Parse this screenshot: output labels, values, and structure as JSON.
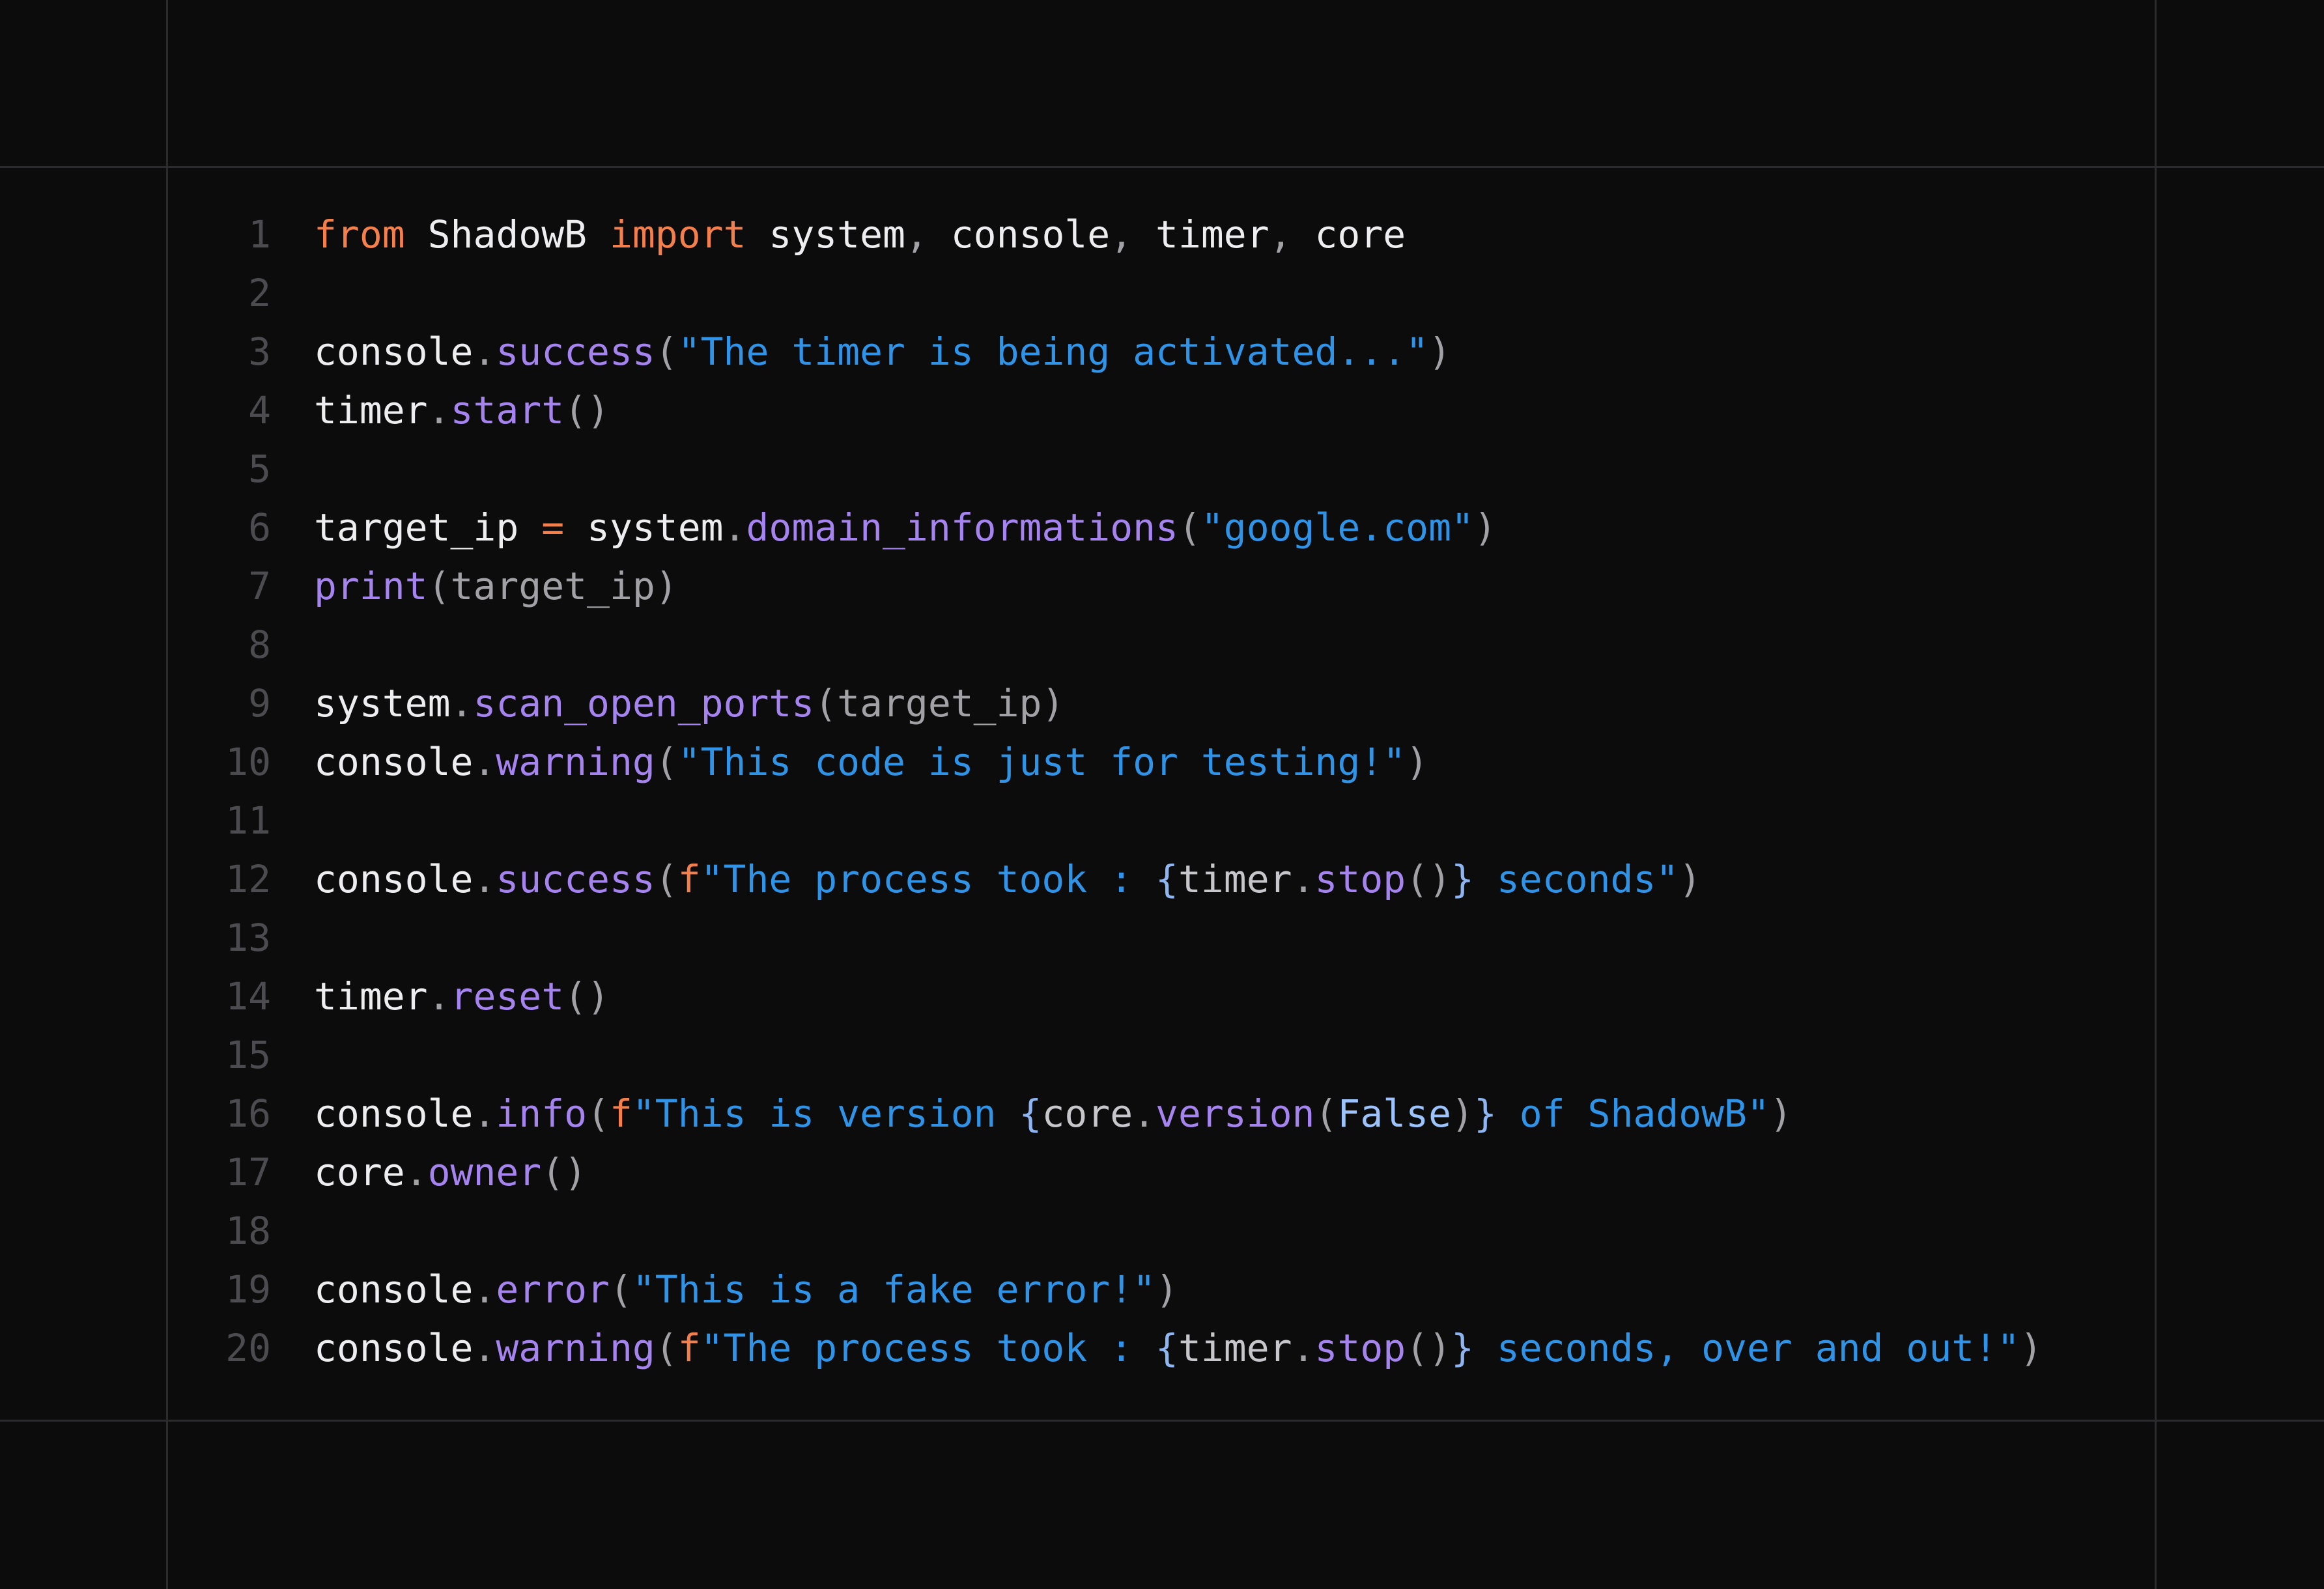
{
  "code": {
    "language": "python",
    "lines": [
      {
        "num": "1",
        "tokens": [
          {
            "t": "from",
            "c": "kw"
          },
          {
            "t": " ShadowB ",
            "c": "plain"
          },
          {
            "t": "import",
            "c": "kw"
          },
          {
            "t": " system",
            "c": "plain"
          },
          {
            "t": ",",
            "c": "punc"
          },
          {
            "t": " console",
            "c": "plain"
          },
          {
            "t": ",",
            "c": "punc"
          },
          {
            "t": " timer",
            "c": "plain"
          },
          {
            "t": ",",
            "c": "punc"
          },
          {
            "t": " core",
            "c": "plain"
          }
        ]
      },
      {
        "num": "2",
        "tokens": []
      },
      {
        "num": "3",
        "tokens": [
          {
            "t": "console",
            "c": "plain"
          },
          {
            "t": ".",
            "c": "punc"
          },
          {
            "t": "success",
            "c": "fn"
          },
          {
            "t": "(",
            "c": "punc"
          },
          {
            "t": "\"The timer is being activated...\"",
            "c": "str"
          },
          {
            "t": ")",
            "c": "punc"
          }
        ]
      },
      {
        "num": "4",
        "tokens": [
          {
            "t": "timer",
            "c": "plain"
          },
          {
            "t": ".",
            "c": "punc"
          },
          {
            "t": "start",
            "c": "fn"
          },
          {
            "t": "()",
            "c": "punc"
          }
        ]
      },
      {
        "num": "5",
        "tokens": []
      },
      {
        "num": "6",
        "tokens": [
          {
            "t": "target_ip ",
            "c": "plain"
          },
          {
            "t": "=",
            "c": "op"
          },
          {
            "t": " system",
            "c": "plain"
          },
          {
            "t": ".",
            "c": "punc"
          },
          {
            "t": "domain_informations",
            "c": "fn"
          },
          {
            "t": "(",
            "c": "punc"
          },
          {
            "t": "\"google.com\"",
            "c": "str"
          },
          {
            "t": ")",
            "c": "punc"
          }
        ]
      },
      {
        "num": "7",
        "tokens": [
          {
            "t": "print",
            "c": "fn"
          },
          {
            "t": "(target_ip)",
            "c": "punc"
          }
        ]
      },
      {
        "num": "8",
        "tokens": []
      },
      {
        "num": "9",
        "tokens": [
          {
            "t": "system",
            "c": "plain"
          },
          {
            "t": ".",
            "c": "punc"
          },
          {
            "t": "scan_open_ports",
            "c": "fn"
          },
          {
            "t": "(target_ip)",
            "c": "punc"
          }
        ]
      },
      {
        "num": "10",
        "tokens": [
          {
            "t": "console",
            "c": "plain"
          },
          {
            "t": ".",
            "c": "punc"
          },
          {
            "t": "warning",
            "c": "fn"
          },
          {
            "t": "(",
            "c": "punc"
          },
          {
            "t": "\"This code is just for testing!\"",
            "c": "str"
          },
          {
            "t": ")",
            "c": "punc"
          }
        ]
      },
      {
        "num": "11",
        "tokens": []
      },
      {
        "num": "12",
        "tokens": [
          {
            "t": "console",
            "c": "plain"
          },
          {
            "t": ".",
            "c": "punc"
          },
          {
            "t": "success",
            "c": "fn"
          },
          {
            "t": "(",
            "c": "punc"
          },
          {
            "t": "f",
            "c": "fstr"
          },
          {
            "t": "\"The process took : ",
            "c": "str"
          },
          {
            "t": "{",
            "c": "brace"
          },
          {
            "t": "timer",
            "c": "interp"
          },
          {
            "t": ".",
            "c": "punc"
          },
          {
            "t": "stop",
            "c": "fn"
          },
          {
            "t": "()",
            "c": "punc"
          },
          {
            "t": "}",
            "c": "brace"
          },
          {
            "t": " seconds\"",
            "c": "str"
          },
          {
            "t": ")",
            "c": "punc"
          }
        ]
      },
      {
        "num": "13",
        "tokens": []
      },
      {
        "num": "14",
        "tokens": [
          {
            "t": "timer",
            "c": "plain"
          },
          {
            "t": ".",
            "c": "punc"
          },
          {
            "t": "reset",
            "c": "fn"
          },
          {
            "t": "()",
            "c": "punc"
          }
        ]
      },
      {
        "num": "15",
        "tokens": []
      },
      {
        "num": "16",
        "tokens": [
          {
            "t": "console",
            "c": "plain"
          },
          {
            "t": ".",
            "c": "punc"
          },
          {
            "t": "info",
            "c": "fn"
          },
          {
            "t": "(",
            "c": "punc"
          },
          {
            "t": "f",
            "c": "fstr"
          },
          {
            "t": "\"This is version ",
            "c": "str"
          },
          {
            "t": "{",
            "c": "brace"
          },
          {
            "t": "core",
            "c": "interp"
          },
          {
            "t": ".",
            "c": "punc"
          },
          {
            "t": "version",
            "c": "fn"
          },
          {
            "t": "(",
            "c": "punc"
          },
          {
            "t": "False",
            "c": "const"
          },
          {
            "t": ")",
            "c": "punc"
          },
          {
            "t": "}",
            "c": "brace"
          },
          {
            "t": " of ShadowB\"",
            "c": "str"
          },
          {
            "t": ")",
            "c": "punc"
          }
        ]
      },
      {
        "num": "17",
        "tokens": [
          {
            "t": "core",
            "c": "plain"
          },
          {
            "t": ".",
            "c": "punc"
          },
          {
            "t": "owner",
            "c": "fn"
          },
          {
            "t": "()",
            "c": "punc"
          }
        ]
      },
      {
        "num": "18",
        "tokens": []
      },
      {
        "num": "19",
        "tokens": [
          {
            "t": "console",
            "c": "plain"
          },
          {
            "t": ".",
            "c": "punc"
          },
          {
            "t": "error",
            "c": "fn"
          },
          {
            "t": "(",
            "c": "punc"
          },
          {
            "t": "\"This is a fake error!\"",
            "c": "str"
          },
          {
            "t": ")",
            "c": "punc"
          }
        ]
      },
      {
        "num": "20",
        "tokens": [
          {
            "t": "console",
            "c": "plain"
          },
          {
            "t": ".",
            "c": "punc"
          },
          {
            "t": "warning",
            "c": "fn"
          },
          {
            "t": "(",
            "c": "punc"
          },
          {
            "t": "f",
            "c": "fstr"
          },
          {
            "t": "\"The process took : ",
            "c": "str"
          },
          {
            "t": "{",
            "c": "brace"
          },
          {
            "t": "timer",
            "c": "interp"
          },
          {
            "t": ".",
            "c": "punc"
          },
          {
            "t": "stop",
            "c": "fn"
          },
          {
            "t": "()",
            "c": "punc"
          },
          {
            "t": "}",
            "c": "brace"
          },
          {
            "t": " seconds, over and out!\"",
            "c": "str"
          },
          {
            "t": ")",
            "c": "punc"
          }
        ]
      }
    ]
  },
  "colors": {
    "background": "#0c0c0d",
    "grid": "#2b2b2e",
    "line_number": "#4b4b50",
    "keyword": "#f47f4b",
    "function": "#a684ef",
    "string": "#2f94e8",
    "identifier": "#eeeef0"
  }
}
